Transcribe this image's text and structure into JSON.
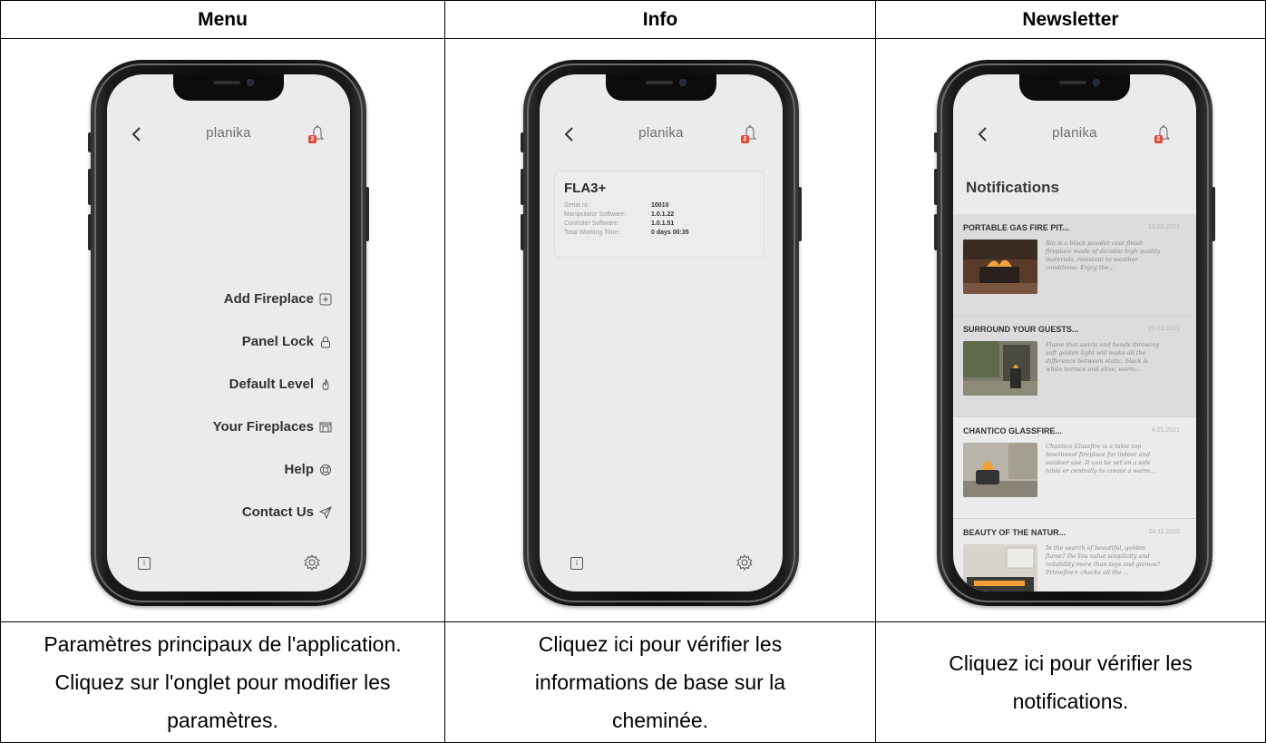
{
  "columns": [
    {
      "header": "Menu",
      "caption": "Paramètres principaux de l'application. Cliquez sur l'onglet pour modifier les paramètres."
    },
    {
      "header": "Info",
      "caption": "Cliquez ici pour vérifier les informations de base sur la cheminée."
    },
    {
      "header": "Newsletter",
      "caption": "Cliquez ici pour vérifier les notifications."
    }
  ],
  "app": {
    "brand": "planika",
    "badge_count": "2",
    "accent_color": "#e24b3b",
    "icons": [
      "back-icon",
      "bell-icon",
      "info-icon",
      "gear-icon"
    ]
  },
  "menu": {
    "items": [
      {
        "label": "Add Fireplace",
        "icon": "plus-square-icon"
      },
      {
        "label": "Panel Lock",
        "icon": "lock-icon"
      },
      {
        "label": "Default Level",
        "icon": "flame-icon"
      },
      {
        "label": "Your Fireplaces",
        "icon": "fireplace-icon"
      },
      {
        "label": "Help",
        "icon": "lifebuoy-icon"
      },
      {
        "label": "Contact Us",
        "icon": "send-icon"
      }
    ]
  },
  "info": {
    "title": "FLA3+",
    "rows": [
      {
        "label": "Serial nr:",
        "value": "10010"
      },
      {
        "label": "Manipulator Software:",
        "value": "1.0.1.22"
      },
      {
        "label": "Controler Software:",
        "value": "1.0.1.51"
      },
      {
        "label": "Total Working Time:",
        "value": "0 days  00:35"
      }
    ]
  },
  "notifications": {
    "heading": "Notifications",
    "items": [
      {
        "title": "PORTABLE GAS FIRE PIT...",
        "date": "13.05.2021",
        "text": "Rio is a black powder coat finish fireplace made of durable high quality materials, resistant to weather conditions. Enjoy the..."
      },
      {
        "title": "SURROUND YOUR GUESTS...",
        "date": "20.03.2021",
        "text": "Flame that swirls and bends throwing soft golden light will make all the difference between static, black & white terrace and alive, warm..."
      },
      {
        "title": "CHANTICO GLASSFIRE...",
        "date": "4.01.2021",
        "text": "Chantico Glassfire is a table top bioethanol fireplace for indoor and outdoor use. It can be set on a side table or centrally to create a warm..."
      },
      {
        "title": "BEAUTY OF THE NATUR...",
        "date": "24.11.2020",
        "text": "In the search of beautiful, golden flame? Do You value simplicity and reliability more than toys and gizmos? Primefire+ checks all the ..."
      }
    ]
  }
}
